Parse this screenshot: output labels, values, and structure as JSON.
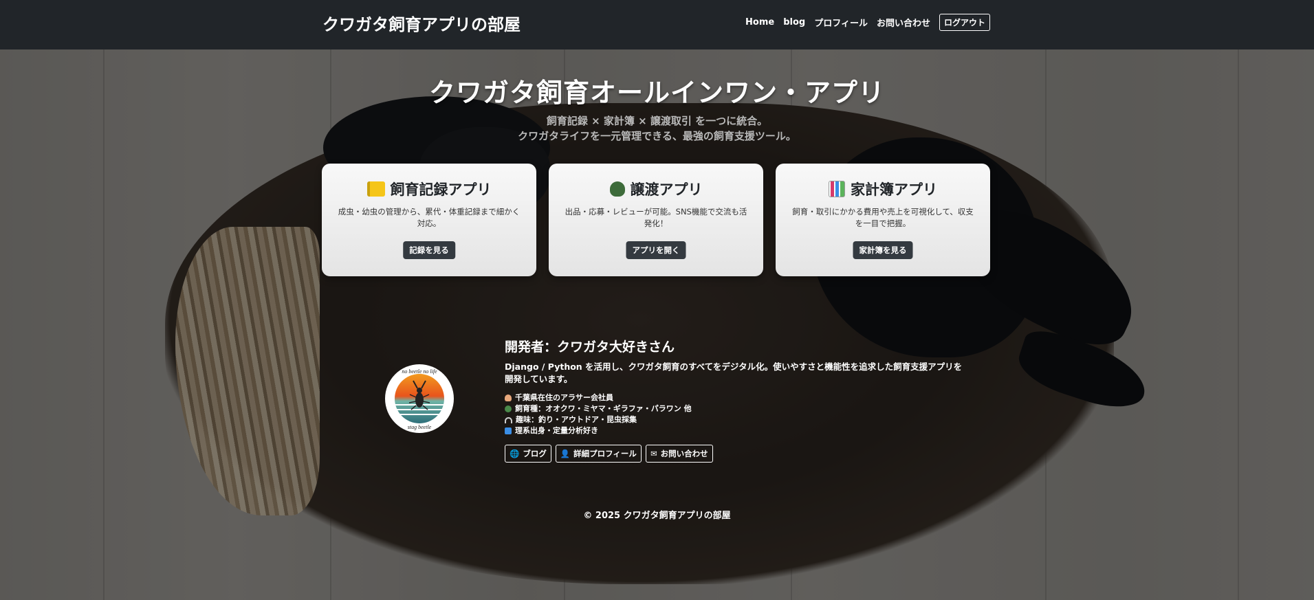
{
  "navbar": {
    "brand": "クワガタ飼育アプリの部屋",
    "links": [
      "Home",
      "blog",
      "プロフィール",
      "お問い合わせ"
    ],
    "logout": "ログアウト"
  },
  "hero": {
    "title": "クワガタ飼育オールインワン・アプリ",
    "subtitle_line1": "飼育記録 × 家計簿 × 譲渡取引 を一つに統合。",
    "subtitle_line2": "クワガタライフを一元管理できる、最強の飼育支援ツール。"
  },
  "cards": [
    {
      "icon": "notebook-icon",
      "icon_color": "#f5c518",
      "title": "飼育記録アプリ",
      "text": "成虫・幼虫の管理から、累代・体重記録まで細かく対応。",
      "button": "記録を見る"
    },
    {
      "icon": "beetle-icon",
      "icon_color": "#3d6b3a",
      "title": "譲渡アプリ",
      "text": "出品・応募・レビューが可能。SNS機能で交流も活発化！",
      "button": "アプリを開く"
    },
    {
      "icon": "bar-chart-icon",
      "icon_color": "#d63b6b",
      "title": "家計簿アプリ",
      "text": "飼育・取引にかかる費用や売上を可視化して、収支を一目で把握。",
      "button": "家計簿を見る"
    }
  ],
  "developer": {
    "avatar_text_top": "no beetle no life",
    "avatar_text_bottom": "stag beetle",
    "name": "開発者：クワガタ大好きさん",
    "description": "Django / Python を活用し、クワガタ飼育のすべてをデジタル化。使いやすさと機能性を追求した飼育支援アプリを開発しています。",
    "facts": [
      {
        "icon": "person-icon",
        "color": "#e8a87c",
        "text": "千葉県在住のアラサー会社員"
      },
      {
        "icon": "beetle-icon",
        "color": "#4a8a4a",
        "text": "飼育種：オオクワ・ミヤマ・ギラファ・パラワン 他"
      },
      {
        "icon": "headphones-icon",
        "color": "#cfcfcf",
        "text": "趣味：釣り・アウトドア・昆虫採集"
      },
      {
        "icon": "book-icon",
        "color": "#3a8ee6",
        "text": "理系出身・定量分析好き"
      }
    ],
    "links": [
      {
        "icon": "globe-icon",
        "label": "ブログ"
      },
      {
        "icon": "user-icon",
        "label": "詳細プロフィール"
      },
      {
        "icon": "mail-icon",
        "label": "お問い合わせ"
      }
    ]
  },
  "footer": "© 2025 クワガタ飼育アプリの部屋"
}
